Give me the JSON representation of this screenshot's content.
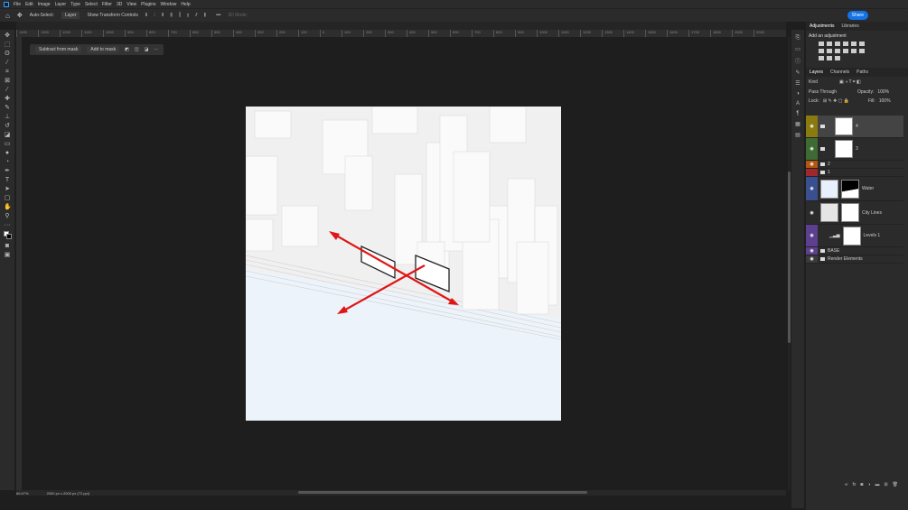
{
  "menu": [
    "File",
    "Edit",
    "Image",
    "Layer",
    "Type",
    "Select",
    "Filter",
    "3D",
    "View",
    "Plugins",
    "Window",
    "Help"
  ],
  "options": {
    "auto_select": "Auto-Select:",
    "layer_select": "Layer",
    "show_transform": "Show Transform Controls",
    "mode_3d": "3D Mode:",
    "share": "Share"
  },
  "ruler": [
    "1400",
    "1300",
    "1200",
    "1100",
    "1000",
    "900",
    "800",
    "700",
    "600",
    "500",
    "400",
    "300",
    "200",
    "100",
    "0",
    "100",
    "200",
    "300",
    "400",
    "500",
    "600",
    "700",
    "800",
    "900",
    "1000",
    "1100",
    "1200",
    "1300",
    "1400",
    "1500",
    "1600",
    "1700",
    "1800",
    "1900",
    "2000"
  ],
  "taskbar": {
    "subtract": "Subtract from mask",
    "add": "Add to mask",
    "more": "···"
  },
  "status": {
    "zoom": "66.67%",
    "doc": "2000 px x 2000 px (72 ppi)"
  },
  "panel": {
    "tabs_top": [
      "Adjustments",
      "Libraries"
    ],
    "add_adjustment": "Add an adjustment",
    "tabs_layers": [
      "Layers",
      "Channels",
      "Paths"
    ],
    "kind": "Kind",
    "blend": "Pass Through",
    "opacity_label": "Opacity:",
    "opacity": "100%",
    "lock_label": "Lock:",
    "fill_label": "Fill:",
    "fill": "100%",
    "layers": [
      {
        "name": "4",
        "color": "#8a7a10",
        "type": "group-mask",
        "selected": true
      },
      {
        "name": "3",
        "color": "#3e6b34",
        "type": "group-mask"
      },
      {
        "name": "2",
        "color": "#b3560f",
        "type": "group"
      },
      {
        "name": "1",
        "color": "#a0282c",
        "type": "group"
      },
      {
        "name": "Water",
        "color": "#3a4f8f",
        "type": "layer-mask"
      },
      {
        "name": "City Lines",
        "color": "",
        "type": "layer-mask"
      },
      {
        "name": "Levels 1",
        "color": "#5d3f8f",
        "type": "adjustment"
      },
      {
        "name": "BASE",
        "color": "#5d3f8f",
        "type": "group"
      },
      {
        "name": "Render Elements",
        "color": "",
        "type": "group"
      }
    ]
  },
  "colors": {
    "accent": "#1473e6",
    "arrow": "#e01515",
    "water": "#edf3fa"
  }
}
